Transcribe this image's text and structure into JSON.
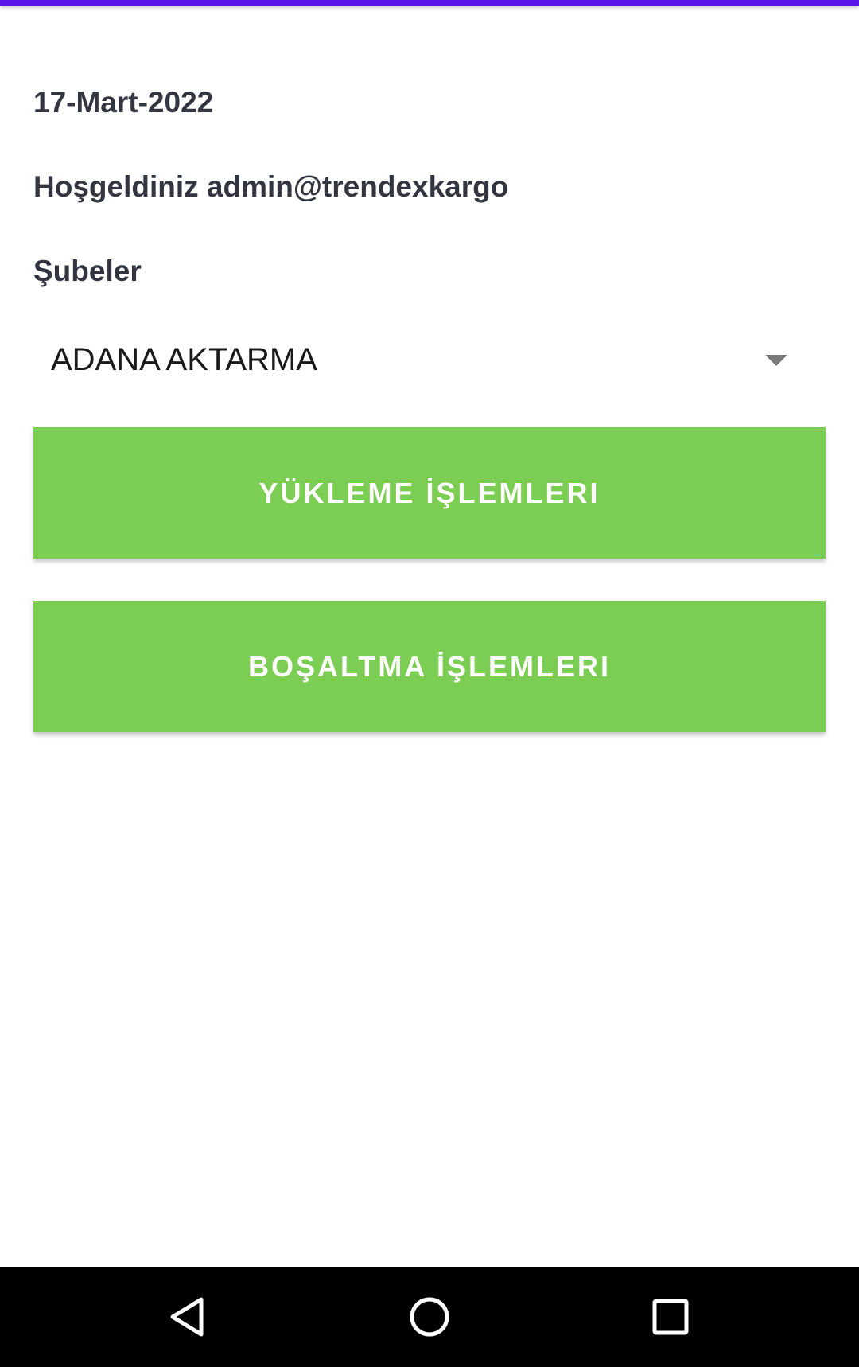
{
  "header": {
    "date": "17-Mart-2022",
    "welcome": "Hoşgeldiniz admin@trendexkargo"
  },
  "branch": {
    "label": "Şubeler",
    "selected": "ADANA AKTARMA"
  },
  "actions": {
    "load_label": "YÜKLEME İŞLEMLERI",
    "unload_label": "BOŞALTMA İŞLEMLERI"
  },
  "colors": {
    "accent_top_bar": "#5b16e8",
    "button_green": "#7ccd54",
    "text_dark": "#333640"
  },
  "nav": {
    "back_icon": "triangle-back-icon",
    "home_icon": "circle-home-icon",
    "recents_icon": "square-recents-icon"
  }
}
